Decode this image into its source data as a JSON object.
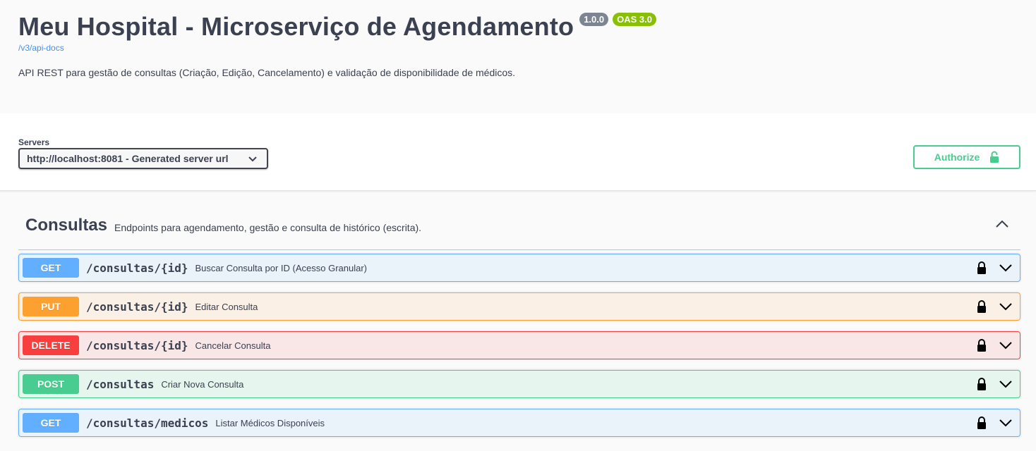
{
  "info": {
    "title": "Meu Hospital - Microserviço de Agendamento",
    "version": "1.0.0",
    "oas": "OAS 3.0",
    "spec_link": "/v3/api-docs",
    "description": "API REST para gestão de consultas (Criação, Edição, Cancelamento) e validação de disponibilidade de médicos."
  },
  "servers": {
    "label": "Servers",
    "selected": "http://localhost:8081 - Generated server url"
  },
  "authorize": {
    "label": "Authorize"
  },
  "tag": {
    "name": "Consultas",
    "description": "Endpoints para agendamento, gestão e consulta de histórico (escrita)."
  },
  "operations": [
    {
      "method": "GET",
      "path": "/consultas/{id}",
      "summary": "Buscar Consulta por ID (Acesso Granular)"
    },
    {
      "method": "PUT",
      "path": "/consultas/{id}",
      "summary": "Editar Consulta"
    },
    {
      "method": "DELETE",
      "path": "/consultas/{id}",
      "summary": "Cancelar Consulta"
    },
    {
      "method": "POST",
      "path": "/consultas",
      "summary": "Criar Nova Consulta"
    },
    {
      "method": "GET",
      "path": "/consultas/medicos",
      "summary": "Listar Médicos Disponíveis"
    }
  ],
  "colors": {
    "get": "#61affe",
    "put": "#fca130",
    "delete": "#f93e3e",
    "post": "#49cc90",
    "version_badge": "#7d8492",
    "oas_badge": "#89bf04",
    "link": "#4990e2"
  },
  "icons": {
    "authorize": "unlocked-padlock-icon",
    "operation_lock": "locked-padlock-icon",
    "operation_expand": "chevron-down-icon",
    "tag_collapse": "chevron-up-icon",
    "server_dropdown": "chevron-down-icon"
  }
}
